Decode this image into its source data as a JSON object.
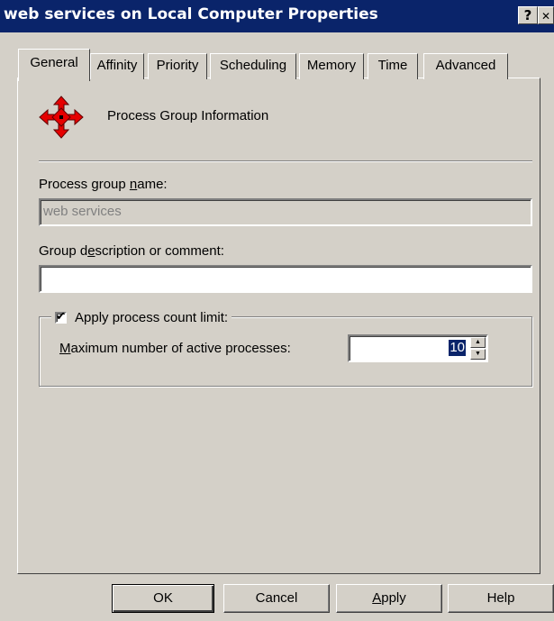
{
  "window": {
    "title": "web services on Local Computer Properties",
    "help_button": "?",
    "close_button": "✕"
  },
  "tabs": [
    {
      "label": "General",
      "active": true
    },
    {
      "label": "Affinity"
    },
    {
      "label": "Priority"
    },
    {
      "label": "Scheduling"
    },
    {
      "label": "Memory"
    },
    {
      "label": "Time"
    },
    {
      "label": "Advanced"
    }
  ],
  "general": {
    "header_icon": "process-group-icon",
    "header_text": "Process Group Information",
    "name_label_pre": "Process group ",
    "name_label_u": "n",
    "name_label_post": "ame:",
    "name_value": "web services",
    "desc_label_pre": "Group d",
    "desc_label_u": "e",
    "desc_label_post": "scription or comment:",
    "desc_value": "",
    "limit_checkbox_label": "Apply process count limit:",
    "limit_checked": true,
    "max_label_u": "M",
    "max_label_post": "aximum number of active processes:",
    "max_value": "10"
  },
  "buttons": {
    "ok": "OK",
    "cancel": "Cancel",
    "apply_u": "A",
    "apply_post": "pply",
    "help": "Help"
  },
  "colors": {
    "titlebar": "#0a246a",
    "face": "#d4d0c8",
    "icon_red": "#e60000"
  }
}
